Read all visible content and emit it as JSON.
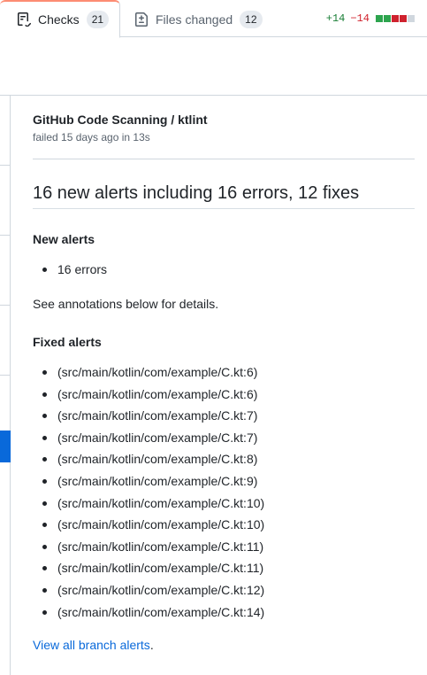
{
  "tabs": {
    "checks": {
      "label": "Checks",
      "count": "21"
    },
    "files": {
      "label": "Files changed",
      "count": "12"
    }
  },
  "diffstat": {
    "additions": "+14",
    "deletions": "−14"
  },
  "check": {
    "title": "GitHub Code Scanning / ktlint",
    "subtitle": "failed 15 days ago in 13s"
  },
  "summary": {
    "heading": "16 new alerts including 16 errors, 12 fixes",
    "new_alerts_heading": "New alerts",
    "new_alerts": [
      "16 errors"
    ],
    "details_text": "See annotations below for details.",
    "fixed_alerts_heading": "Fixed alerts",
    "fixed_alerts": [
      "(src/main/kotlin/com/example/C.kt:6)",
      "(src/main/kotlin/com/example/C.kt:6)",
      "(src/main/kotlin/com/example/C.kt:7)",
      "(src/main/kotlin/com/example/C.kt:7)",
      "(src/main/kotlin/com/example/C.kt:8)",
      "(src/main/kotlin/com/example/C.kt:9)",
      "(src/main/kotlin/com/example/C.kt:10)",
      "(src/main/kotlin/com/example/C.kt:10)",
      "(src/main/kotlin/com/example/C.kt:11)",
      "(src/main/kotlin/com/example/C.kt:11)",
      "(src/main/kotlin/com/example/C.kt:12)",
      "(src/main/kotlin/com/example/C.kt:14)"
    ],
    "view_all_link": "View all branch alerts",
    "view_all_suffix": "."
  },
  "colors": {
    "accent": "#0969da",
    "additions": "#1a7f37",
    "deletions": "#d1242f",
    "tab_highlight": "#fd8c73"
  }
}
